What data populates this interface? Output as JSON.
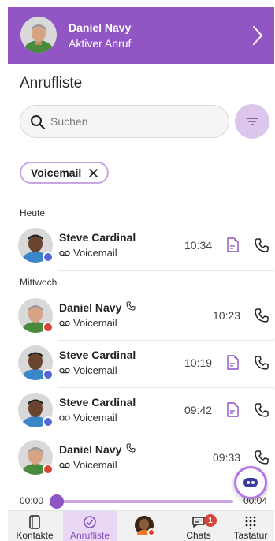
{
  "active_call": {
    "name": "Daniel Navy",
    "status": "Aktiver Anruf",
    "banner_color": "#9256c4"
  },
  "page_title": "Anrufliste",
  "search": {
    "placeholder": "Suchen",
    "value": ""
  },
  "filter_chip": {
    "label": "Voicemail"
  },
  "sections": [
    {
      "header": "Heute",
      "rows": [
        {
          "name": "Steve Cardinal",
          "type": "Voicemail",
          "time": "10:34",
          "presence": "blue",
          "has_transcript": true,
          "name_phone_icon": false
        }
      ]
    },
    {
      "header": "Mittwoch",
      "rows": [
        {
          "name": "Daniel Navy",
          "type": "Voicemail",
          "time": "10:23",
          "presence": "red",
          "has_transcript": false,
          "name_phone_icon": true
        },
        {
          "name": "Steve Cardinal",
          "type": "Voicemail",
          "time": "10:19",
          "presence": "blue",
          "has_transcript": true,
          "name_phone_icon": false
        },
        {
          "name": "Steve Cardinal",
          "type": "Voicemail",
          "time": "09:42",
          "presence": "blue",
          "has_transcript": true,
          "name_phone_icon": false
        },
        {
          "name": "Daniel Navy",
          "type": "Voicemail",
          "time": "09:33",
          "presence": "red",
          "has_transcript": false,
          "name_phone_icon": true
        }
      ]
    }
  ],
  "player": {
    "current": "00:00",
    "total": "00:04",
    "progress": 0.0
  },
  "tabs": [
    {
      "label": "Kontakte",
      "icon": "phone-book-icon",
      "active": false
    },
    {
      "label": "Anrufliste",
      "icon": "call-history-icon",
      "active": true
    },
    {
      "label": "",
      "icon": "profile-avatar",
      "active": false
    },
    {
      "label": "Chats",
      "icon": "chat-icon",
      "active": false,
      "badge": "1"
    },
    {
      "label": "Tastatur",
      "icon": "dialpad-icon",
      "active": false
    }
  ],
  "colors": {
    "accent": "#8b4fc4",
    "presence_available": "#5565d9",
    "presence_busy": "#d9443a"
  }
}
